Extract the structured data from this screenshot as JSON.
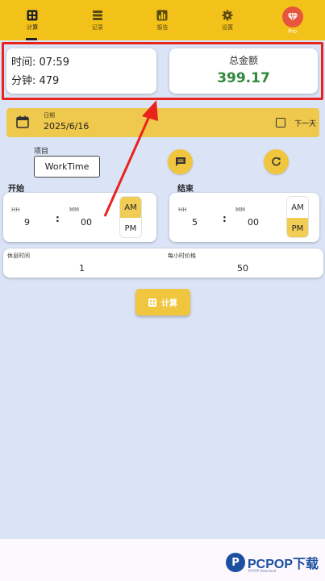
{
  "nav": {
    "items": [
      {
        "label": "计算",
        "icon": "calculator-icon"
      },
      {
        "label": "记录",
        "icon": "list-icon"
      },
      {
        "label": "报告",
        "icon": "bar-chart-icon"
      },
      {
        "label": "设置",
        "icon": "gear-icon"
      },
      {
        "label": "Pro",
        "icon": "diamond-icon"
      }
    ],
    "active_index": 0
  },
  "summary": {
    "time_label": "时间: 07:59",
    "minutes_label": "分钟: 479",
    "total_label": "总金额",
    "total_value": "399.17"
  },
  "date": {
    "label": "日期",
    "value": "2025/6/16",
    "next_day_label": "下一天"
  },
  "project": {
    "label": "项目",
    "value": "WorkTime"
  },
  "start": {
    "label": "开始",
    "hh_label": "HH",
    "mm_label": "MM",
    "hour": "9",
    "minute": "00",
    "am": "AM",
    "pm": "PM",
    "selected": "AM"
  },
  "end": {
    "label": "结束",
    "hh_label": "HH",
    "mm_label": "MM",
    "hour": "5",
    "minute": "00",
    "am": "AM",
    "pm": "PM",
    "selected": "PM"
  },
  "rest": {
    "label": "休息时间",
    "value": "1"
  },
  "rate": {
    "label": "每小时价格",
    "value": "50"
  },
  "calculate_label": "计算",
  "watermark": {
    "logo": "P",
    "text": "PCPOP下载",
    "sub": "PCPOP Download"
  },
  "colors": {
    "primary": "#f3c21a",
    "accent": "#f1c63f",
    "background": "#dae4f6",
    "total_green": "#2f8a39",
    "highlight_red": "#e8231c"
  }
}
